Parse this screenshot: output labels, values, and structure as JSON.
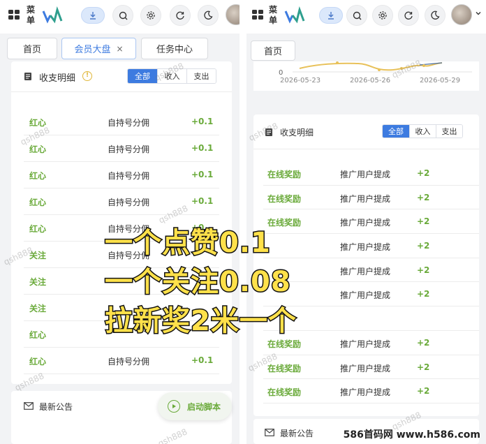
{
  "left_panel": {
    "header": {
      "menu_label_1": "菜",
      "menu_label_2": "单"
    },
    "tabs": [
      {
        "label": "首页"
      },
      {
        "label": "会员大盘",
        "close": "×"
      },
      {
        "label": "任务中心"
      }
    ],
    "ledger": {
      "title": "收支明细",
      "info": "!",
      "filters": [
        "全部",
        "收入",
        "支出"
      ],
      "rows": [
        {
          "type": "红心",
          "desc": "自持号分佣",
          "amount": "+0.1"
        },
        {
          "type": "红心",
          "desc": "自持号分佣",
          "amount": "+0.1"
        },
        {
          "type": "红心",
          "desc": "自持号分佣",
          "amount": "+0.1"
        },
        {
          "type": "红心",
          "desc": "自持号分佣",
          "amount": "+0.1"
        },
        {
          "type": "红心",
          "desc": "自持号分佣",
          "amount": "+0"
        },
        {
          "type": "关注",
          "desc": "自持号分佣",
          "amount": ""
        },
        {
          "type": "关注",
          "desc": "",
          "amount": ""
        },
        {
          "type": "关注",
          "desc": "",
          "amount": ""
        },
        {
          "type": "红心",
          "desc": "",
          "amount": ""
        },
        {
          "type": "红心",
          "desc": "自持号分佣",
          "amount": "+0.1"
        }
      ]
    },
    "notice": {
      "title": "最新公告"
    },
    "fab": {
      "label": "启动脚本"
    }
  },
  "right_panel": {
    "header": {
      "menu_label_1": "菜",
      "menu_label_2": "单"
    },
    "tabs": [
      {
        "label": "首页"
      }
    ],
    "chart_data": {
      "type": "line",
      "x": [
        "2026-05-23",
        "2026-05-26",
        "2026-05-29"
      ],
      "ytick": "0",
      "series_color": "#e8c15a"
    },
    "ledger": {
      "title": "收支明细",
      "filters": [
        "全部",
        "收入",
        "支出"
      ],
      "rows": [
        {
          "type": "在线奖励",
          "desc": "推广用户提成",
          "amount": "+2"
        },
        {
          "type": "在线奖励",
          "desc": "推广用户提成",
          "amount": "+2"
        },
        {
          "type": "在线奖励",
          "desc": "推广用户提成",
          "amount": "+2"
        },
        {
          "type": "",
          "desc": "推广用户提成",
          "amount": "+2"
        },
        {
          "type": "",
          "desc": "推广用户提成",
          "amount": "+2"
        },
        {
          "type": "",
          "desc": "推广用户提成",
          "amount": "+2"
        },
        {
          "type": "",
          "desc": "",
          "amount": ""
        },
        {
          "type": "在线奖励",
          "desc": "推广用户提成",
          "amount": "+2"
        },
        {
          "type": "在线奖励",
          "desc": "推广用户提成",
          "amount": "+2"
        },
        {
          "type": "在线奖励",
          "desc": "推广用户提成",
          "amount": "+2"
        }
      ]
    },
    "notice": {
      "title": "最新公告"
    }
  },
  "overlay": {
    "line1": "一个点赞0.1",
    "line2": "一个关注0.08",
    "line3": "拉新奖2米一个"
  },
  "watermark": "qsh888",
  "footer": "586首码网 www.h586.com",
  "colors": {
    "accent": "#3d7be0",
    "green": "#6aaa3a",
    "overlay_fill": "#ffe14a"
  }
}
